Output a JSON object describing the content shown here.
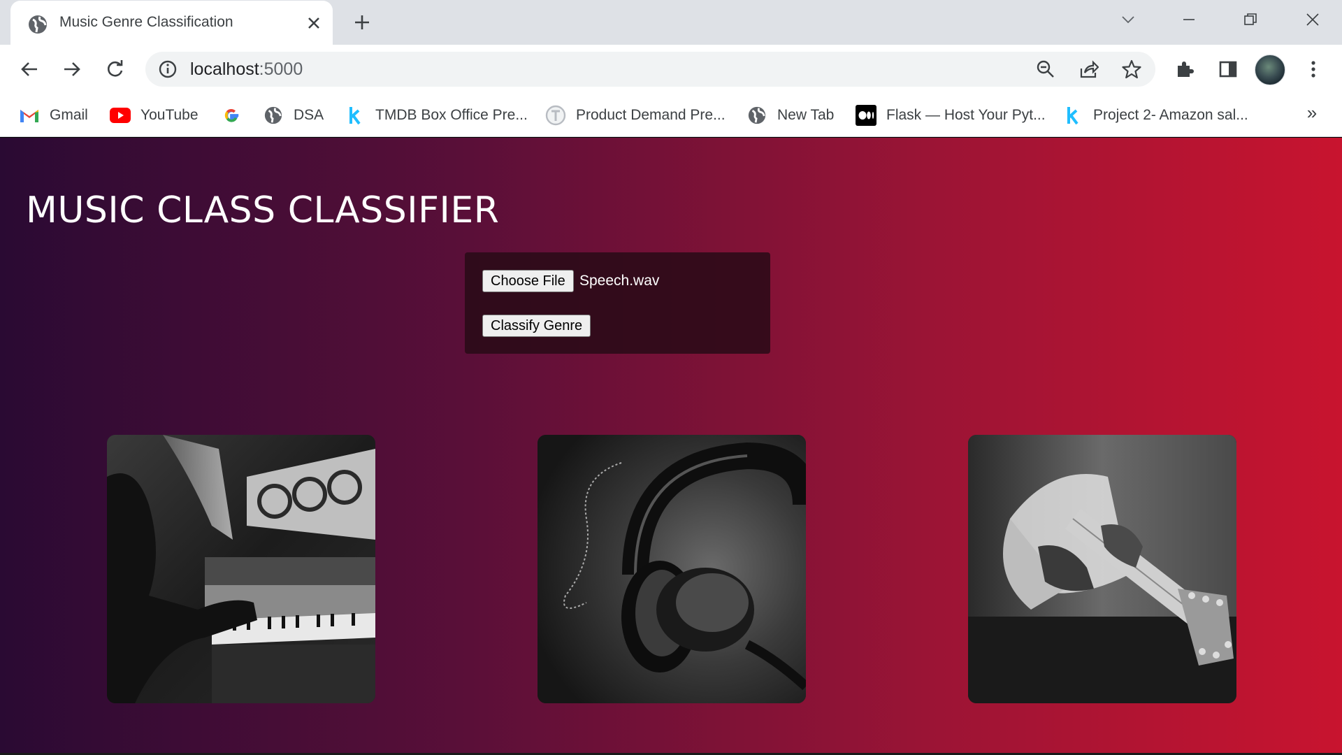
{
  "browser": {
    "tab_title": "Music Genre Classification",
    "url_host": "localhost",
    "url_port": ":5000",
    "bookmarks": [
      {
        "label": "Gmail",
        "icon": "gmail-icon"
      },
      {
        "label": "YouTube",
        "icon": "youtube-icon"
      },
      {
        "label": "",
        "icon": "google-icon"
      },
      {
        "label": "DSA",
        "icon": "globe-icon"
      },
      {
        "label": "TMDB Box Office Pre...",
        "icon": "kaggle-icon"
      },
      {
        "label": "Product Demand Pre...",
        "icon": "t-icon"
      },
      {
        "label": "New Tab",
        "icon": "globe-icon"
      },
      {
        "label": "Flask — Host Your Pyt...",
        "icon": "medium-icon"
      },
      {
        "label": "Project 2- Amazon sal...",
        "icon": "kaggle-icon"
      }
    ],
    "more_bookmarks": "»"
  },
  "page": {
    "title": "MUSIC CLASS CLASSIFIER",
    "choose_file_label": "Choose File",
    "chosen_file": "Speech.wav",
    "classify_label": "Classify Genre",
    "images": [
      "piano-photo",
      "headphones-photo",
      "guitar-photo"
    ]
  },
  "colors": {
    "gradient_start": "#2a0a33",
    "gradient_end": "#c8142f",
    "panel_bg": "#280a16"
  }
}
